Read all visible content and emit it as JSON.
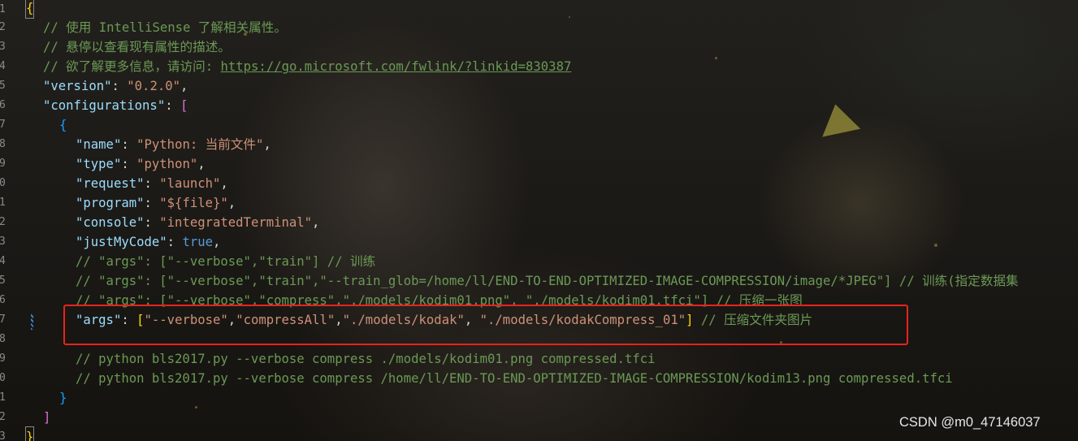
{
  "gutter": {
    "line_numbers": [
      "1",
      "2",
      "3",
      "4",
      "5",
      "6",
      "7",
      "8",
      "9",
      "0",
      "1",
      "2",
      "3",
      "4",
      "5",
      "6",
      "7",
      "8",
      "9",
      "0",
      "1",
      "2",
      "3"
    ]
  },
  "code": {
    "line1": {
      "open_brace": "{"
    },
    "line2": {
      "comment": "// 使用 IntelliSense 了解相关属性。"
    },
    "line3": {
      "comment": "// 悬停以查看现有属性的描述。"
    },
    "line4": {
      "comment": "// 欲了解更多信息，请访问: ",
      "link": "https://go.microsoft.com/fwlink/?linkid=830387"
    },
    "line5": {
      "key": "\"version\"",
      "sep": ": ",
      "value": "\"0.2.0\"",
      "end": ","
    },
    "line6": {
      "key": "\"configurations\"",
      "sep": ": ",
      "bracket": "["
    },
    "line7": {
      "brace": "{"
    },
    "line8": {
      "key": "\"name\"",
      "sep": ": ",
      "value": "\"Python: 当前文件\"",
      "end": ","
    },
    "line9": {
      "key": "\"type\"",
      "sep": ": ",
      "value": "\"python\"",
      "end": ","
    },
    "line10": {
      "key": "\"request\"",
      "sep": ": ",
      "value": "\"launch\"",
      "end": ","
    },
    "line11": {
      "key": "\"program\"",
      "sep": ": ",
      "value": "\"${file}\"",
      "end": ","
    },
    "line12": {
      "key": "\"console\"",
      "sep": ": ",
      "value": "\"integratedTerminal\"",
      "end": ","
    },
    "line13": {
      "key": "\"justMyCode\"",
      "sep": ": ",
      "value": "true",
      "end": ","
    },
    "line14": {
      "comment": "// \"args\": [\"--verbose\",\"train\"] // 训练"
    },
    "line15": {
      "comment": "// \"args\": [\"--verbose\",\"train\",\"--train_glob=/home/ll/END-TO-END-OPTIMIZED-IMAGE-COMPRESSION/image/*JPEG\"] // 训练(指定数据集"
    },
    "line16": {
      "comment": "// \"args\": [\"--verbose\",\"compress\",\"./models/kodim01.png\", \"./models/kodim01.tfci\"] // 压缩一张图"
    },
    "line17": {
      "key": "\"args\"",
      "sep": ": ",
      "bracket_open": "[",
      "v1": "\"--verbose\"",
      "comma1": ",",
      "v2": "\"compressAll\"",
      "comma2": ",",
      "v3": "\"./models/kodak\"",
      "comma3": ", ",
      "v4": "\"./models/kodakCompress_01\"",
      "bracket_close": "]",
      "space": " ",
      "comment": "// 压缩文件夹图片"
    },
    "line18": {
      "text": ""
    },
    "line19": {
      "comment": "// python bls2017.py --verbose compress ./models/kodim01.png compressed.tfci"
    },
    "line20": {
      "comment": "// python bls2017.py --verbose compress /home/ll/END-TO-END-OPTIMIZED-IMAGE-COMPRESSION/kodim13.png compressed.tfci"
    },
    "line21": {
      "brace": "}"
    },
    "line22": {
      "bracket": "]"
    },
    "line23": {
      "close_brace": "}"
    }
  },
  "watermark": {
    "text": "CSDN @m0_47146037"
  },
  "colors": {
    "string": "#ce9178",
    "key": "#9cdcfe",
    "comment": "#6a9955",
    "keyword": "#569cd6",
    "bracket_gold": "#ffd700",
    "bracket_purple": "#da70d6",
    "bracket_blue": "#179fff",
    "highlight_box": "#e8231d"
  }
}
